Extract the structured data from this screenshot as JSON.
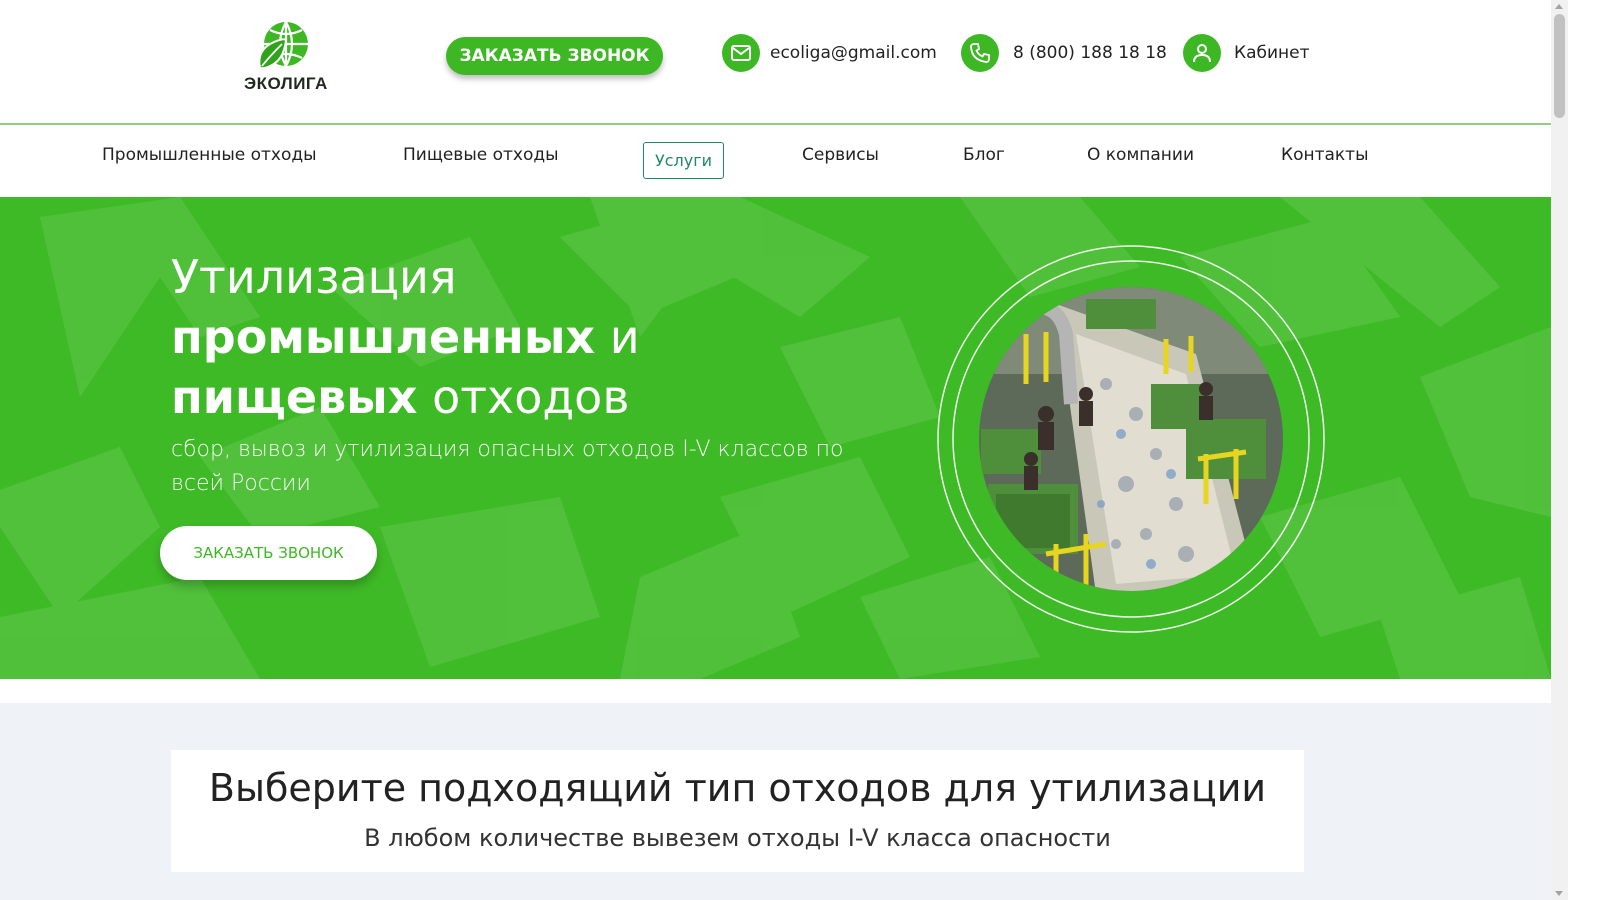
{
  "header": {
    "logo_text": "ЭКОЛИГА",
    "call_button": "ЗАКАЗАТЬ ЗВОНОК",
    "email": "ecoliga@gmail.com",
    "phone": "8 (800) 188 18 18",
    "cabinet": "Кабинет",
    "icons": {
      "email": "envelope-icon",
      "phone": "phone-icon",
      "cabinet": "user-icon"
    }
  },
  "nav": {
    "items": [
      {
        "label": "Промышленные отходы"
      },
      {
        "label": "Пищевые отходы"
      },
      {
        "label": "Услуги",
        "active": true
      },
      {
        "label": "Сервисы"
      },
      {
        "label": "Блог"
      },
      {
        "label": "О компании"
      },
      {
        "label": "Контакты"
      }
    ]
  },
  "hero": {
    "title_line1": "Утилизация",
    "title_bold2": "промышленных",
    "title_rest2": " и",
    "title_bold3": "пищевых",
    "title_rest3": " отходов",
    "subtitle": "сбор, вывоз и утилизация опасных отходов I-V классов по всей России",
    "button": "ЗАКАЗАТЬ ЗВОНОК",
    "image": "waste-sorting-facility-photo"
  },
  "section": {
    "title": "Выберите подходящий тип отходов для утилизации",
    "subtitle": "В любом количестве вывезем отходы I-V класса опасности"
  },
  "colors": {
    "brand_green": "#3db824",
    "hero_green": "#3fba27",
    "nav_active": "#1f8a63",
    "section_bg": "#eff2f6"
  }
}
